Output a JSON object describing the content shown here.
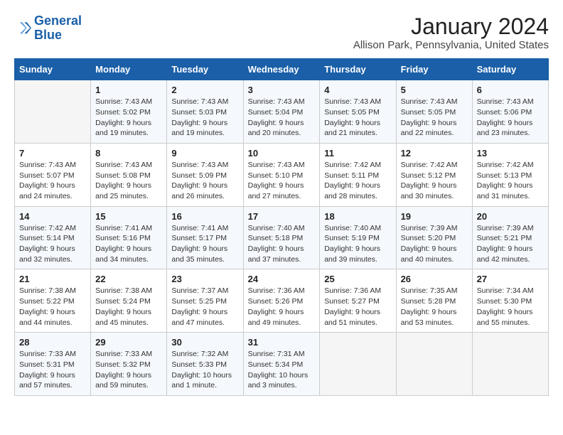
{
  "header": {
    "logo_line1": "General",
    "logo_line2": "Blue",
    "month": "January 2024",
    "location": "Allison Park, Pennsylvania, United States"
  },
  "days_of_week": [
    "Sunday",
    "Monday",
    "Tuesday",
    "Wednesday",
    "Thursday",
    "Friday",
    "Saturday"
  ],
  "weeks": [
    [
      {
        "day": "",
        "info": ""
      },
      {
        "day": "1",
        "info": "Sunrise: 7:43 AM\nSunset: 5:02 PM\nDaylight: 9 hours\nand 19 minutes."
      },
      {
        "day": "2",
        "info": "Sunrise: 7:43 AM\nSunset: 5:03 PM\nDaylight: 9 hours\nand 19 minutes."
      },
      {
        "day": "3",
        "info": "Sunrise: 7:43 AM\nSunset: 5:04 PM\nDaylight: 9 hours\nand 20 minutes."
      },
      {
        "day": "4",
        "info": "Sunrise: 7:43 AM\nSunset: 5:05 PM\nDaylight: 9 hours\nand 21 minutes."
      },
      {
        "day": "5",
        "info": "Sunrise: 7:43 AM\nSunset: 5:05 PM\nDaylight: 9 hours\nand 22 minutes."
      },
      {
        "day": "6",
        "info": "Sunrise: 7:43 AM\nSunset: 5:06 PM\nDaylight: 9 hours\nand 23 minutes."
      }
    ],
    [
      {
        "day": "7",
        "info": "Sunrise: 7:43 AM\nSunset: 5:07 PM\nDaylight: 9 hours\nand 24 minutes."
      },
      {
        "day": "8",
        "info": "Sunrise: 7:43 AM\nSunset: 5:08 PM\nDaylight: 9 hours\nand 25 minutes."
      },
      {
        "day": "9",
        "info": "Sunrise: 7:43 AM\nSunset: 5:09 PM\nDaylight: 9 hours\nand 26 minutes."
      },
      {
        "day": "10",
        "info": "Sunrise: 7:43 AM\nSunset: 5:10 PM\nDaylight: 9 hours\nand 27 minutes."
      },
      {
        "day": "11",
        "info": "Sunrise: 7:42 AM\nSunset: 5:11 PM\nDaylight: 9 hours\nand 28 minutes."
      },
      {
        "day": "12",
        "info": "Sunrise: 7:42 AM\nSunset: 5:12 PM\nDaylight: 9 hours\nand 30 minutes."
      },
      {
        "day": "13",
        "info": "Sunrise: 7:42 AM\nSunset: 5:13 PM\nDaylight: 9 hours\nand 31 minutes."
      }
    ],
    [
      {
        "day": "14",
        "info": "Sunrise: 7:42 AM\nSunset: 5:14 PM\nDaylight: 9 hours\nand 32 minutes."
      },
      {
        "day": "15",
        "info": "Sunrise: 7:41 AM\nSunset: 5:16 PM\nDaylight: 9 hours\nand 34 minutes."
      },
      {
        "day": "16",
        "info": "Sunrise: 7:41 AM\nSunset: 5:17 PM\nDaylight: 9 hours\nand 35 minutes."
      },
      {
        "day": "17",
        "info": "Sunrise: 7:40 AM\nSunset: 5:18 PM\nDaylight: 9 hours\nand 37 minutes."
      },
      {
        "day": "18",
        "info": "Sunrise: 7:40 AM\nSunset: 5:19 PM\nDaylight: 9 hours\nand 39 minutes."
      },
      {
        "day": "19",
        "info": "Sunrise: 7:39 AM\nSunset: 5:20 PM\nDaylight: 9 hours\nand 40 minutes."
      },
      {
        "day": "20",
        "info": "Sunrise: 7:39 AM\nSunset: 5:21 PM\nDaylight: 9 hours\nand 42 minutes."
      }
    ],
    [
      {
        "day": "21",
        "info": "Sunrise: 7:38 AM\nSunset: 5:22 PM\nDaylight: 9 hours\nand 44 minutes."
      },
      {
        "day": "22",
        "info": "Sunrise: 7:38 AM\nSunset: 5:24 PM\nDaylight: 9 hours\nand 45 minutes."
      },
      {
        "day": "23",
        "info": "Sunrise: 7:37 AM\nSunset: 5:25 PM\nDaylight: 9 hours\nand 47 minutes."
      },
      {
        "day": "24",
        "info": "Sunrise: 7:36 AM\nSunset: 5:26 PM\nDaylight: 9 hours\nand 49 minutes."
      },
      {
        "day": "25",
        "info": "Sunrise: 7:36 AM\nSunset: 5:27 PM\nDaylight: 9 hours\nand 51 minutes."
      },
      {
        "day": "26",
        "info": "Sunrise: 7:35 AM\nSunset: 5:28 PM\nDaylight: 9 hours\nand 53 minutes."
      },
      {
        "day": "27",
        "info": "Sunrise: 7:34 AM\nSunset: 5:30 PM\nDaylight: 9 hours\nand 55 minutes."
      }
    ],
    [
      {
        "day": "28",
        "info": "Sunrise: 7:33 AM\nSunset: 5:31 PM\nDaylight: 9 hours\nand 57 minutes."
      },
      {
        "day": "29",
        "info": "Sunrise: 7:33 AM\nSunset: 5:32 PM\nDaylight: 9 hours\nand 59 minutes."
      },
      {
        "day": "30",
        "info": "Sunrise: 7:32 AM\nSunset: 5:33 PM\nDaylight: 10 hours\nand 1 minute."
      },
      {
        "day": "31",
        "info": "Sunrise: 7:31 AM\nSunset: 5:34 PM\nDaylight: 10 hours\nand 3 minutes."
      },
      {
        "day": "",
        "info": ""
      },
      {
        "day": "",
        "info": ""
      },
      {
        "day": "",
        "info": ""
      }
    ]
  ]
}
